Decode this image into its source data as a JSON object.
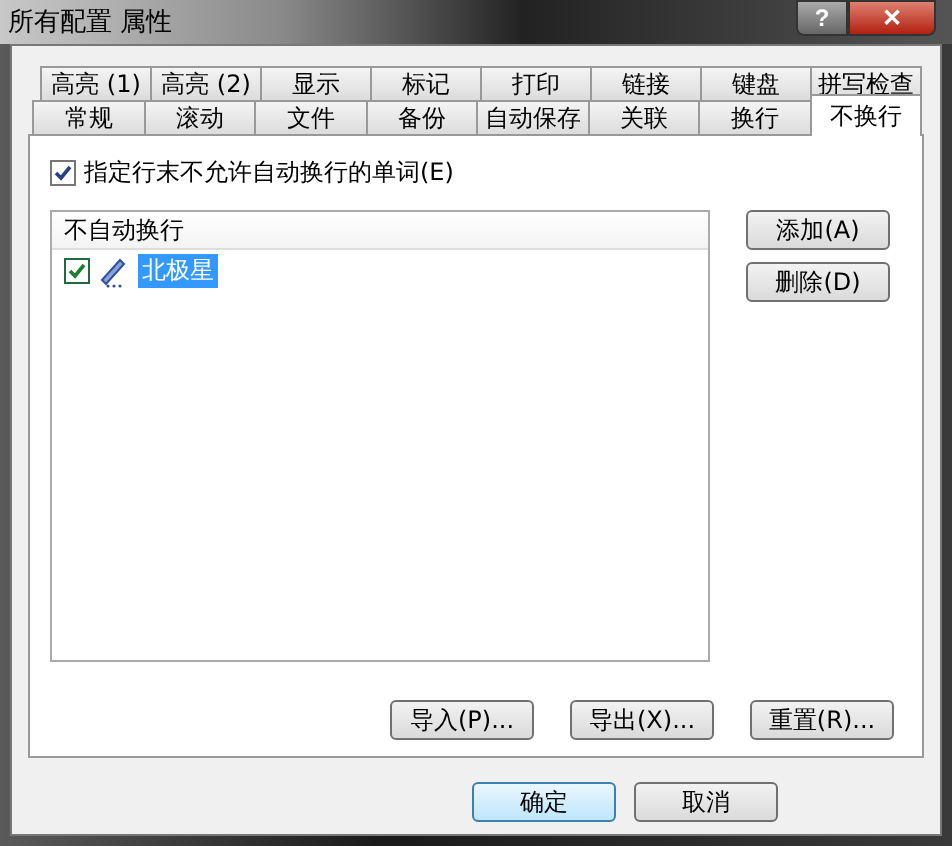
{
  "window": {
    "title": "所有配置 属性",
    "help": "?",
    "close": "✕"
  },
  "tab_rows": [
    [
      {
        "label": "高亮 (1)",
        "selected": false
      },
      {
        "label": "高亮 (2)",
        "selected": false
      },
      {
        "label": "显示",
        "selected": false
      },
      {
        "label": "标记",
        "selected": false
      },
      {
        "label": "打印",
        "selected": false
      },
      {
        "label": "链接",
        "selected": false
      },
      {
        "label": "键盘",
        "selected": false
      },
      {
        "label": "拼写检查",
        "selected": false
      }
    ],
    [
      {
        "label": "常规",
        "selected": false
      },
      {
        "label": "滚动",
        "selected": false
      },
      {
        "label": "文件",
        "selected": false
      },
      {
        "label": "备份",
        "selected": false
      },
      {
        "label": "自动保存",
        "selected": false
      },
      {
        "label": "关联",
        "selected": false
      },
      {
        "label": "换行",
        "selected": false
      },
      {
        "label": "不换行",
        "selected": true
      }
    ]
  ],
  "option": {
    "label": "指定行末不允许自动换行的单词(E)",
    "checked": true
  },
  "list": {
    "header": "不自动换行",
    "items": [
      {
        "label": "北极星",
        "checked": true,
        "selected": true
      }
    ]
  },
  "side_buttons": [
    "添加(A)",
    "删除(D)"
  ],
  "panel_buttons": [
    "导入(P)...",
    "导出(X)...",
    "重置(R)..."
  ],
  "dialog_buttons": [
    {
      "label": "确定",
      "default": true
    },
    {
      "label": "取消",
      "default": false
    }
  ]
}
